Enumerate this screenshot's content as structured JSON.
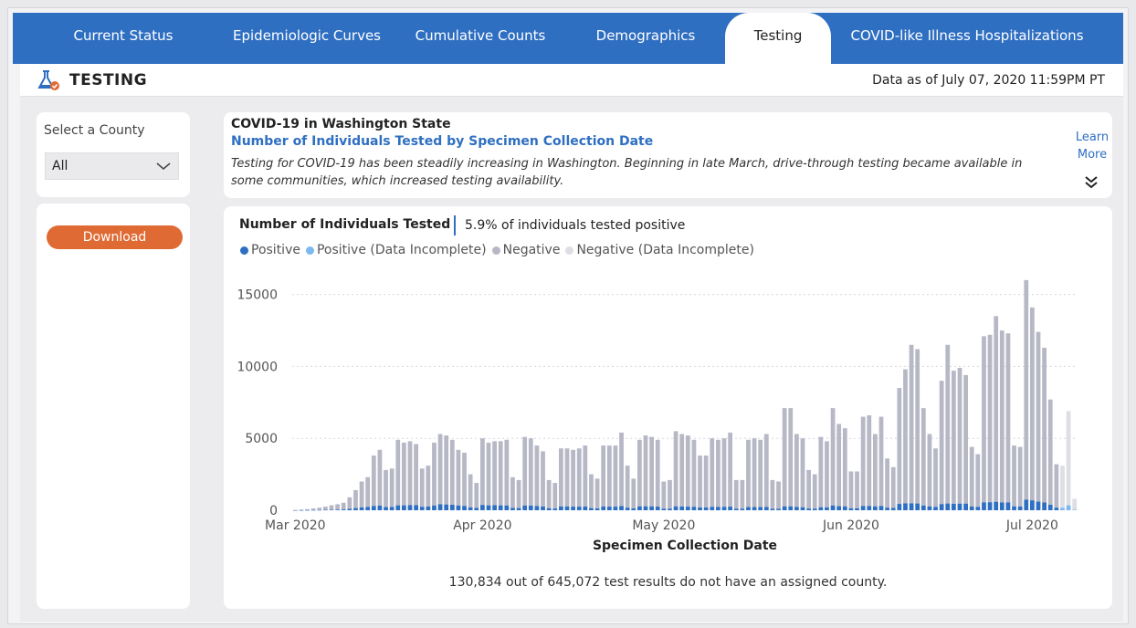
{
  "tabs": [
    {
      "label": "Current Status",
      "active": false
    },
    {
      "label": "Epidemiologic Curves",
      "active": false
    },
    {
      "label": "Cumulative Counts",
      "active": false
    },
    {
      "label": "Demographics",
      "active": false
    },
    {
      "label": "Testing",
      "active": true
    },
    {
      "label": "COVID-like Illness Hospitalizations",
      "active": false
    }
  ],
  "header": {
    "title": "TESTING",
    "as_of": "Data as of July 07, 2020 11:59PM PT"
  },
  "sidebar": {
    "select_label": "Select a County",
    "select_value": "All",
    "download_label": "Download"
  },
  "intro": {
    "heading": "COVID-19 in Washington State",
    "subheading": "Number of Individuals Tested by Specimen Collection Date",
    "description": "Testing for COVID-19 has been steadily increasing in Washington. Beginning in late March, drive-through testing became available in some communities, which increased testing availability.",
    "learn_more": "Learn More"
  },
  "chart_header": {
    "title": "Number of Individuals Tested",
    "positivity": "5.9% of individuals tested positive"
  },
  "colors": {
    "positive": "#2f6fc2",
    "positive_incomplete": "#7db8ee",
    "negative": "#b7b8c6",
    "negative_incomplete": "#dedfe4",
    "accent": "#2f6fc2",
    "download": "#e06a33"
  },
  "note": "130,834 out of 645,072 test results do not have an assigned county.",
  "chart_data": {
    "type": "bar",
    "stacked": true,
    "title": "Number of Individuals Tested",
    "xlabel": "Specimen Collection Date",
    "ylabel": "",
    "ylim": [
      0,
      16500
    ],
    "yticks": [
      0,
      5000,
      10000,
      15000
    ],
    "x_tick_labels": [
      "Mar 2020",
      "Apr 2020",
      "May 2020",
      "Jun 2020",
      "Jul 2020"
    ],
    "x_tick_index": [
      0,
      31,
      61,
      92,
      122
    ],
    "grid": true,
    "legend_position": "top-left",
    "legend": [
      "Positive",
      "Positive (Data Incomplete)",
      "Negative",
      "Negative (Data Incomplete)"
    ],
    "start_date": "2020-03-01",
    "incomplete_from_index": 127,
    "totals": [
      20,
      50,
      80,
      130,
      180,
      250,
      350,
      420,
      520,
      900,
      1400,
      2000,
      2300,
      3800,
      4200,
      2800,
      2900,
      4900,
      4700,
      4800,
      4600,
      2900,
      3100,
      4700,
      5300,
      5200,
      4900,
      4200,
      4000,
      2500,
      1900,
      5000,
      4700,
      4800,
      4800,
      4900,
      2300,
      2100,
      5100,
      5000,
      4500,
      4100,
      2100,
      1900,
      4300,
      4300,
      4200,
      4300,
      4500,
      2500,
      2200,
      4500,
      4500,
      4500,
      5400,
      3100,
      2200,
      4900,
      5200,
      5100,
      4900,
      2000,
      2100,
      5500,
      5300,
      5200,
      4900,
      3800,
      3800,
      5000,
      4900,
      5000,
      5400,
      2100,
      2100,
      4900,
      5000,
      4900,
      5300,
      2100,
      2000,
      7100,
      7100,
      5300,
      5000,
      2800,
      2500,
      5100,
      4800,
      7100,
      6000,
      5700,
      2700,
      2700,
      6500,
      6600,
      5300,
      6500,
      3600,
      3000,
      8500,
      9800,
      11500,
      11200,
      7100,
      5300,
      4300,
      9000,
      11500,
      9700,
      9900,
      9400,
      4400,
      3900,
      12100,
      12200,
      13500,
      12500,
      12300,
      4500,
      4400,
      16000,
      14100,
      12400,
      11300,
      7700,
      3200,
      3100,
      6900,
      800
    ],
    "positive": [
      3,
      5,
      8,
      10,
      15,
      25,
      35,
      45,
      60,
      100,
      150,
      200,
      230,
      300,
      320,
      220,
      230,
      340,
      340,
      360,
      350,
      240,
      260,
      330,
      420,
      400,
      380,
      330,
      300,
      200,
      160,
      370,
      340,
      350,
      340,
      330,
      160,
      150,
      330,
      320,
      290,
      260,
      140,
      120,
      260,
      260,
      250,
      250,
      260,
      150,
      130,
      260,
      250,
      250,
      290,
      180,
      130,
      270,
      270,
      270,
      250,
      110,
      110,
      270,
      260,
      250,
      240,
      190,
      190,
      240,
      230,
      240,
      250,
      110,
      110,
      220,
      220,
      220,
      230,
      100,
      100,
      270,
      270,
      230,
      210,
      120,
      110,
      210,
      200,
      330,
      280,
      270,
      140,
      140,
      300,
      300,
      270,
      300,
      180,
      160,
      440,
      480,
      480,
      470,
      330,
      270,
      230,
      430,
      470,
      450,
      460,
      460,
      260,
      240,
      550,
      560,
      590,
      540,
      540,
      270,
      260,
      740,
      690,
      600,
      540,
      380,
      180,
      170,
      340,
      40
    ]
  }
}
